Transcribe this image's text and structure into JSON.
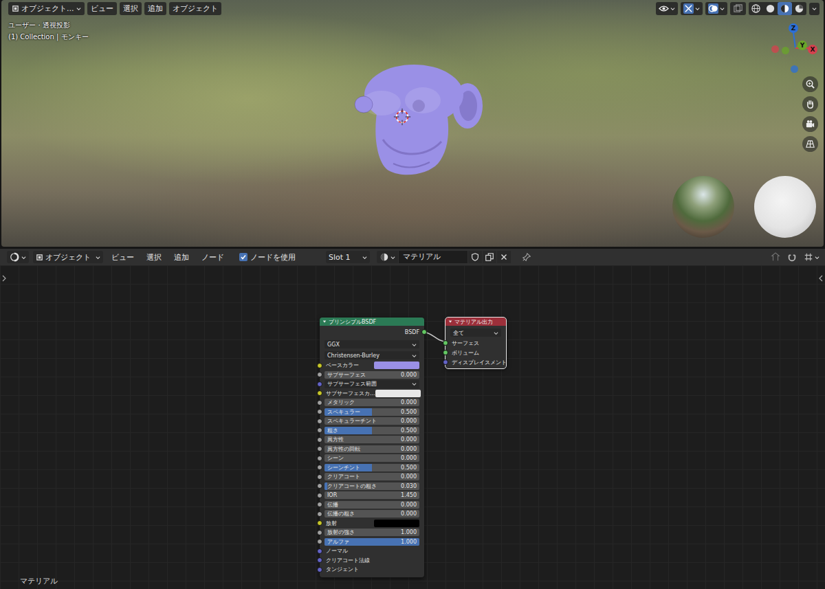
{
  "viewport": {
    "header": {
      "editor_mode": "オブジェクト...",
      "menus": [
        "ビュー",
        "選択",
        "追加",
        "オブジェクト"
      ]
    },
    "info": {
      "view": "ユーザー・透視投影",
      "context": "(1) Collection | モンキー"
    },
    "gizmo": [
      {
        "label": "Z",
        "color": "#2c6fd6"
      },
      {
        "label": "Y",
        "color": "#6aa629"
      },
      {
        "label": "X",
        "color": "#d5414e"
      }
    ],
    "shading": [
      {
        "kind": "wireframe",
        "selected": false
      },
      {
        "kind": "solid",
        "selected": false
      },
      {
        "kind": "material",
        "selected": true
      },
      {
        "kind": "rendered",
        "selected": false
      }
    ]
  },
  "node_editor": {
    "header": {
      "mode": "オブジェクト",
      "menus": [
        "ビュー",
        "選択",
        "追加",
        "ノード"
      ],
      "use_nodes": {
        "label": "ノードを使用",
        "checked": true
      },
      "slot": "Slot 1",
      "material": "マテリアル"
    },
    "nodes": [
      {
        "title": "プリンシプルBSDF",
        "color": "#2b7a55",
        "outputs": [
          {
            "label": "BSDF",
            "socket": "#63c763"
          }
        ],
        "options": [
          "GGX",
          "Christensen-Burley"
        ],
        "inputs": [
          {
            "label": "ベースカラー",
            "kind": "color",
            "swatch": "#9a90e6",
            "socket": "#c7c729"
          },
          {
            "label": "サブサーフェス",
            "kind": "slider",
            "value": "0.000",
            "level": 0,
            "socket": "#a1a1a1"
          },
          {
            "label": "サブサーフェス範囲",
            "kind": "dropdown",
            "socket": "#6363c7"
          },
          {
            "label": "サブサーフェスカ...",
            "kind": "color",
            "swatch": "#e8e8e8",
            "socket": "#c7c729"
          },
          {
            "label": "メタリック",
            "kind": "slider",
            "value": "0.000",
            "level": 0,
            "socket": "#a1a1a1"
          },
          {
            "label": "スペキュラー",
            "kind": "slider",
            "value": "0.500",
            "level": 0.5,
            "socket": "#a1a1a1"
          },
          {
            "label": "スペキュラーチント",
            "kind": "slider",
            "value": "0.000",
            "level": 0,
            "socket": "#a1a1a1"
          },
          {
            "label": "粗さ",
            "kind": "slider",
            "value": "0.500",
            "level": 0.5,
            "socket": "#a1a1a1"
          },
          {
            "label": "異方性",
            "kind": "slider",
            "value": "0.000",
            "level": 0,
            "socket": "#a1a1a1"
          },
          {
            "label": "異方性の回転",
            "kind": "slider",
            "value": "0.000",
            "level": 0,
            "socket": "#a1a1a1"
          },
          {
            "label": "シーン",
            "kind": "slider",
            "value": "0.000",
            "level": 0,
            "socket": "#a1a1a1"
          },
          {
            "label": "シーンチント",
            "kind": "slider",
            "value": "0.500",
            "level": 0.5,
            "socket": "#a1a1a1"
          },
          {
            "label": "クリアコート",
            "kind": "slider",
            "value": "0.000",
            "level": 0,
            "socket": "#a1a1a1"
          },
          {
            "label": "クリアコートの粗さ",
            "kind": "slider",
            "value": "0.030",
            "level": 0.03,
            "socket": "#a1a1a1"
          },
          {
            "label": "IOR",
            "kind": "number",
            "value": "1.450",
            "socket": "#a1a1a1"
          },
          {
            "label": "伝播",
            "kind": "slider",
            "value": "0.000",
            "level": 0,
            "socket": "#a1a1a1"
          },
          {
            "label": "伝播の粗さ",
            "kind": "slider",
            "value": "0.000",
            "level": 0,
            "socket": "#a1a1a1"
          },
          {
            "label": "放射",
            "kind": "color",
            "swatch": "#000000",
            "socket": "#c7c729"
          },
          {
            "label": "放射の強さ",
            "kind": "number",
            "value": "1.000",
            "socket": "#a1a1a1"
          },
          {
            "label": "アルファ",
            "kind": "slider",
            "value": "1.000",
            "level": 1,
            "socket": "#a1a1a1"
          },
          {
            "label": "ノーマル",
            "kind": "socket",
            "socket": "#6363c7"
          },
          {
            "label": "クリアコート法線",
            "kind": "socket",
            "socket": "#6363c7"
          },
          {
            "label": "タンジェント",
            "kind": "socket",
            "socket": "#6363c7"
          }
        ]
      },
      {
        "title": "マテリアル出力",
        "color": "#9c2f3a",
        "outputs": [],
        "options": [
          "全て"
        ],
        "inputs": [
          {
            "label": "サーフェス",
            "kind": "socket",
            "socket": "#63c763"
          },
          {
            "label": "ボリューム",
            "kind": "socket",
            "socket": "#63c763"
          },
          {
            "label": "ディスプレイスメント",
            "kind": "socket",
            "socket": "#6363c7"
          }
        ]
      }
    ],
    "footer": "マテリアル"
  }
}
